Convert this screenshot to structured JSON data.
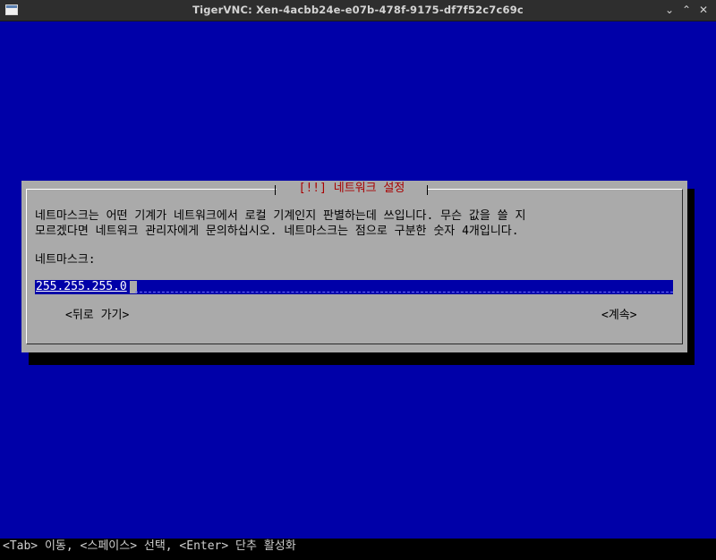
{
  "window": {
    "title": "TigerVNC: Xen-4acbb24e-e07b-478f-9175-df7f52c7c69c",
    "minimize_glyph": "⌄",
    "maximize_glyph": "⌃",
    "close_glyph": "✕"
  },
  "dialog": {
    "title": "[!!] 네트워크 설정",
    "description_line1": "네트마스크는 어떤 기계가 네트워크에서 로컬 기계인지 판별하는데 쓰입니다. 무슨 값을 쓸 지",
    "description_line2": "모르겠다면 네트워크 관리자에게 문의하십시오. 네트마스크는 점으로 구분한 숫자 4개입니다.",
    "field_label": "네트마스크:",
    "field_value": "255.255.255.0",
    "back_button": "<뒤로 가기>",
    "continue_button": "<계속>"
  },
  "status": {
    "hint": "<Tab> 이동, <스페이스> 선택, <Enter> 단추 활성화"
  },
  "colors": {
    "background": "#0000a8",
    "dialog": "#aaaaaa",
    "title_text": "#a80000",
    "input_bg": "#0000a8"
  },
  "icons": {
    "app": "window-icon",
    "minimize": "chevron-down-icon",
    "maximize": "chevron-up-icon",
    "close": "close-icon"
  }
}
